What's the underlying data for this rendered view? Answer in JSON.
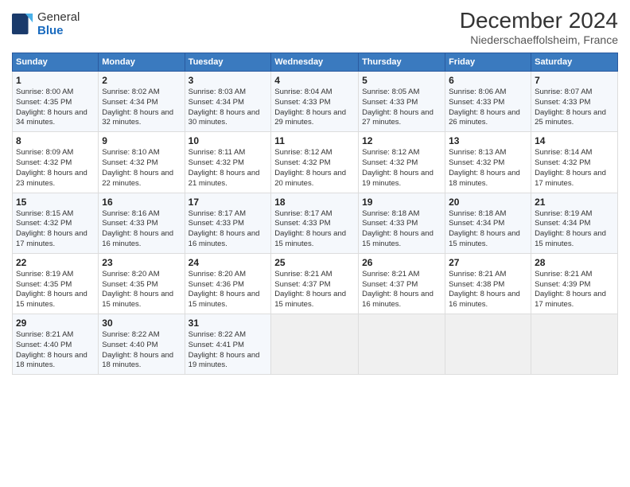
{
  "logo": {
    "general": "General",
    "blue": "Blue"
  },
  "title": "December 2024",
  "location": "Niederschaeffolsheim, France",
  "days_of_week": [
    "Sunday",
    "Monday",
    "Tuesday",
    "Wednesday",
    "Thursday",
    "Friday",
    "Saturday"
  ],
  "weeks": [
    [
      {
        "day": 1,
        "sunrise": "8:00 AM",
        "sunset": "4:35 PM",
        "daylight": "8 hours and 34 minutes."
      },
      {
        "day": 2,
        "sunrise": "8:02 AM",
        "sunset": "4:34 PM",
        "daylight": "8 hours and 32 minutes."
      },
      {
        "day": 3,
        "sunrise": "8:03 AM",
        "sunset": "4:34 PM",
        "daylight": "8 hours and 30 minutes."
      },
      {
        "day": 4,
        "sunrise": "8:04 AM",
        "sunset": "4:33 PM",
        "daylight": "8 hours and 29 minutes."
      },
      {
        "day": 5,
        "sunrise": "8:05 AM",
        "sunset": "4:33 PM",
        "daylight": "8 hours and 27 minutes."
      },
      {
        "day": 6,
        "sunrise": "8:06 AM",
        "sunset": "4:33 PM",
        "daylight": "8 hours and 26 minutes."
      },
      {
        "day": 7,
        "sunrise": "8:07 AM",
        "sunset": "4:33 PM",
        "daylight": "8 hours and 25 minutes."
      }
    ],
    [
      {
        "day": 8,
        "sunrise": "8:09 AM",
        "sunset": "4:32 PM",
        "daylight": "8 hours and 23 minutes."
      },
      {
        "day": 9,
        "sunrise": "8:10 AM",
        "sunset": "4:32 PM",
        "daylight": "8 hours and 22 minutes."
      },
      {
        "day": 10,
        "sunrise": "8:11 AM",
        "sunset": "4:32 PM",
        "daylight": "8 hours and 21 minutes."
      },
      {
        "day": 11,
        "sunrise": "8:12 AM",
        "sunset": "4:32 PM",
        "daylight": "8 hours and 20 minutes."
      },
      {
        "day": 12,
        "sunrise": "8:12 AM",
        "sunset": "4:32 PM",
        "daylight": "8 hours and 19 minutes."
      },
      {
        "day": 13,
        "sunrise": "8:13 AM",
        "sunset": "4:32 PM",
        "daylight": "8 hours and 18 minutes."
      },
      {
        "day": 14,
        "sunrise": "8:14 AM",
        "sunset": "4:32 PM",
        "daylight": "8 hours and 17 minutes."
      }
    ],
    [
      {
        "day": 15,
        "sunrise": "8:15 AM",
        "sunset": "4:32 PM",
        "daylight": "8 hours and 17 minutes."
      },
      {
        "day": 16,
        "sunrise": "8:16 AM",
        "sunset": "4:33 PM",
        "daylight": "8 hours and 16 minutes."
      },
      {
        "day": 17,
        "sunrise": "8:17 AM",
        "sunset": "4:33 PM",
        "daylight": "8 hours and 16 minutes."
      },
      {
        "day": 18,
        "sunrise": "8:17 AM",
        "sunset": "4:33 PM",
        "daylight": "8 hours and 15 minutes."
      },
      {
        "day": 19,
        "sunrise": "8:18 AM",
        "sunset": "4:33 PM",
        "daylight": "8 hours and 15 minutes."
      },
      {
        "day": 20,
        "sunrise": "8:18 AM",
        "sunset": "4:34 PM",
        "daylight": "8 hours and 15 minutes."
      },
      {
        "day": 21,
        "sunrise": "8:19 AM",
        "sunset": "4:34 PM",
        "daylight": "8 hours and 15 minutes."
      }
    ],
    [
      {
        "day": 22,
        "sunrise": "8:19 AM",
        "sunset": "4:35 PM",
        "daylight": "8 hours and 15 minutes."
      },
      {
        "day": 23,
        "sunrise": "8:20 AM",
        "sunset": "4:35 PM",
        "daylight": "8 hours and 15 minutes."
      },
      {
        "day": 24,
        "sunrise": "8:20 AM",
        "sunset": "4:36 PM",
        "daylight": "8 hours and 15 minutes."
      },
      {
        "day": 25,
        "sunrise": "8:21 AM",
        "sunset": "4:37 PM",
        "daylight": "8 hours and 15 minutes."
      },
      {
        "day": 26,
        "sunrise": "8:21 AM",
        "sunset": "4:37 PM",
        "daylight": "8 hours and 16 minutes."
      },
      {
        "day": 27,
        "sunrise": "8:21 AM",
        "sunset": "4:38 PM",
        "daylight": "8 hours and 16 minutes."
      },
      {
        "day": 28,
        "sunrise": "8:21 AM",
        "sunset": "4:39 PM",
        "daylight": "8 hours and 17 minutes."
      }
    ],
    [
      {
        "day": 29,
        "sunrise": "8:21 AM",
        "sunset": "4:40 PM",
        "daylight": "8 hours and 18 minutes."
      },
      {
        "day": 30,
        "sunrise": "8:22 AM",
        "sunset": "4:40 PM",
        "daylight": "8 hours and 18 minutes."
      },
      {
        "day": 31,
        "sunrise": "8:22 AM",
        "sunset": "4:41 PM",
        "daylight": "8 hours and 19 minutes."
      },
      null,
      null,
      null,
      null
    ]
  ]
}
